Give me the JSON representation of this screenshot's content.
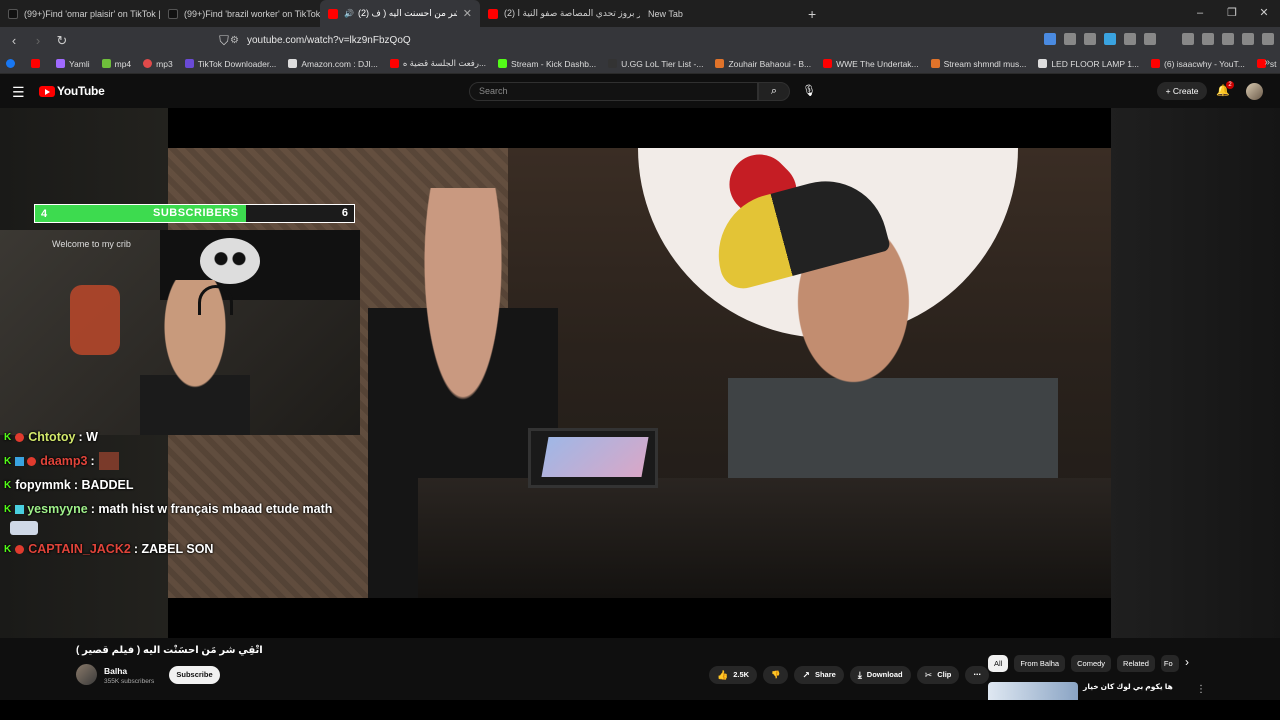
{
  "browser": {
    "tabs": [
      {
        "title": "(99+)Find 'omar plaisir' on TikTok | T",
        "favicon_color": "#111111"
      },
      {
        "title": "(99+)Find 'brazil worker' on TikTok | T",
        "favicon_color": "#111111"
      },
      {
        "title": "(2) القي شر من احسنت اليه ( ف",
        "favicon_color": "#ff0000"
      },
      {
        "title": "(2) امير بروز تحدي المصاصة صفو النية ا",
        "favicon_color": "#ff0000"
      },
      {
        "title": "New Tab",
        "favicon_color": "#35363a"
      }
    ],
    "active_tab_index": 2,
    "new_tab_label": "+",
    "window_controls": {
      "minimize": "–",
      "maximize": "❐",
      "close": "✕"
    },
    "url": "youtube.com/watch?v=lkz9nFbzQoQ",
    "bookmarks": [
      {
        "label": "",
        "color": "#1877f2"
      },
      {
        "label": "",
        "color": "#ff0000"
      },
      {
        "label": "Yamli",
        "color": "#a06aff"
      },
      {
        "label": "mp4",
        "color": "#6fbf3b"
      },
      {
        "label": "mp3",
        "color": "#e04a4a"
      },
      {
        "label": "TikTok Downloader...",
        "color": "#6a4ad6"
      },
      {
        "label": "Amazon.com : DJI...",
        "color": "#dddddd"
      },
      {
        "label": "رفعت الجلسة قضية ه...",
        "color": "#ff0000"
      },
      {
        "label": "Stream - Kick Dashb...",
        "color": "#53fc18"
      },
      {
        "label": "U.GG LoL Tier List -...",
        "color": "#333333"
      },
      {
        "label": "Zouhair Bahaoui - B...",
        "color": "#e0732a"
      },
      {
        "label": "WWE The Undertak...",
        "color": "#ff0000"
      },
      {
        "label": "Stream shmndl mus...",
        "color": "#e0732a"
      },
      {
        "label": "LED FLOOR LAMP 1...",
        "color": "#dddddd"
      },
      {
        "label": "(6) isaacwhy - YouT...",
        "color": "#ff0000"
      },
      {
        "label": "st",
        "color": "#ff0000"
      }
    ]
  },
  "youtube": {
    "logo": "YouTube",
    "search_placeholder": "Search",
    "create_label": "Create",
    "notification_count": "2"
  },
  "stream_overlay": {
    "subscribers_label": "SUBSCRIBERS",
    "subscribers_left": "4",
    "subscribers_right": "6",
    "subscribers_progress": 0.66,
    "webcam_sign": "Welcome to my crib",
    "chat": [
      {
        "user": "Chtotoy",
        "message": "W",
        "user_color": "#d2e86b"
      },
      {
        "user": "daamp3",
        "message": "",
        "user_color": "#e0443a",
        "has_emote": true
      },
      {
        "user": "fopymmk",
        "message": "BADDEL",
        "user_color": "#ffffff"
      },
      {
        "user": "yesmyyne",
        "message": "math hist w français mbaad etude math",
        "user_color": "#9ff08a"
      },
      {
        "user": "CAPTAIN_JACK2",
        "message": "ZABEL SON",
        "user_color": "#e0443a"
      }
    ]
  },
  "video_info": {
    "title": "اتْقِي شر مَن احسَنْت اليه ( فيلم قصير )",
    "channel": "Balha",
    "subscribers": "355K subscribers",
    "subscribe_label": "Subscribe",
    "likes": "2.5K",
    "share_label": "Share",
    "download_label": "Download",
    "clip_label": "Clip",
    "more_label": "⋯"
  },
  "related": {
    "chips": [
      "All",
      "From Balha",
      "Comedy",
      "Related",
      "Fo"
    ],
    "selected_chip": "All",
    "first_rec_title": "ها يكوم بي لوك كان خيار"
  }
}
